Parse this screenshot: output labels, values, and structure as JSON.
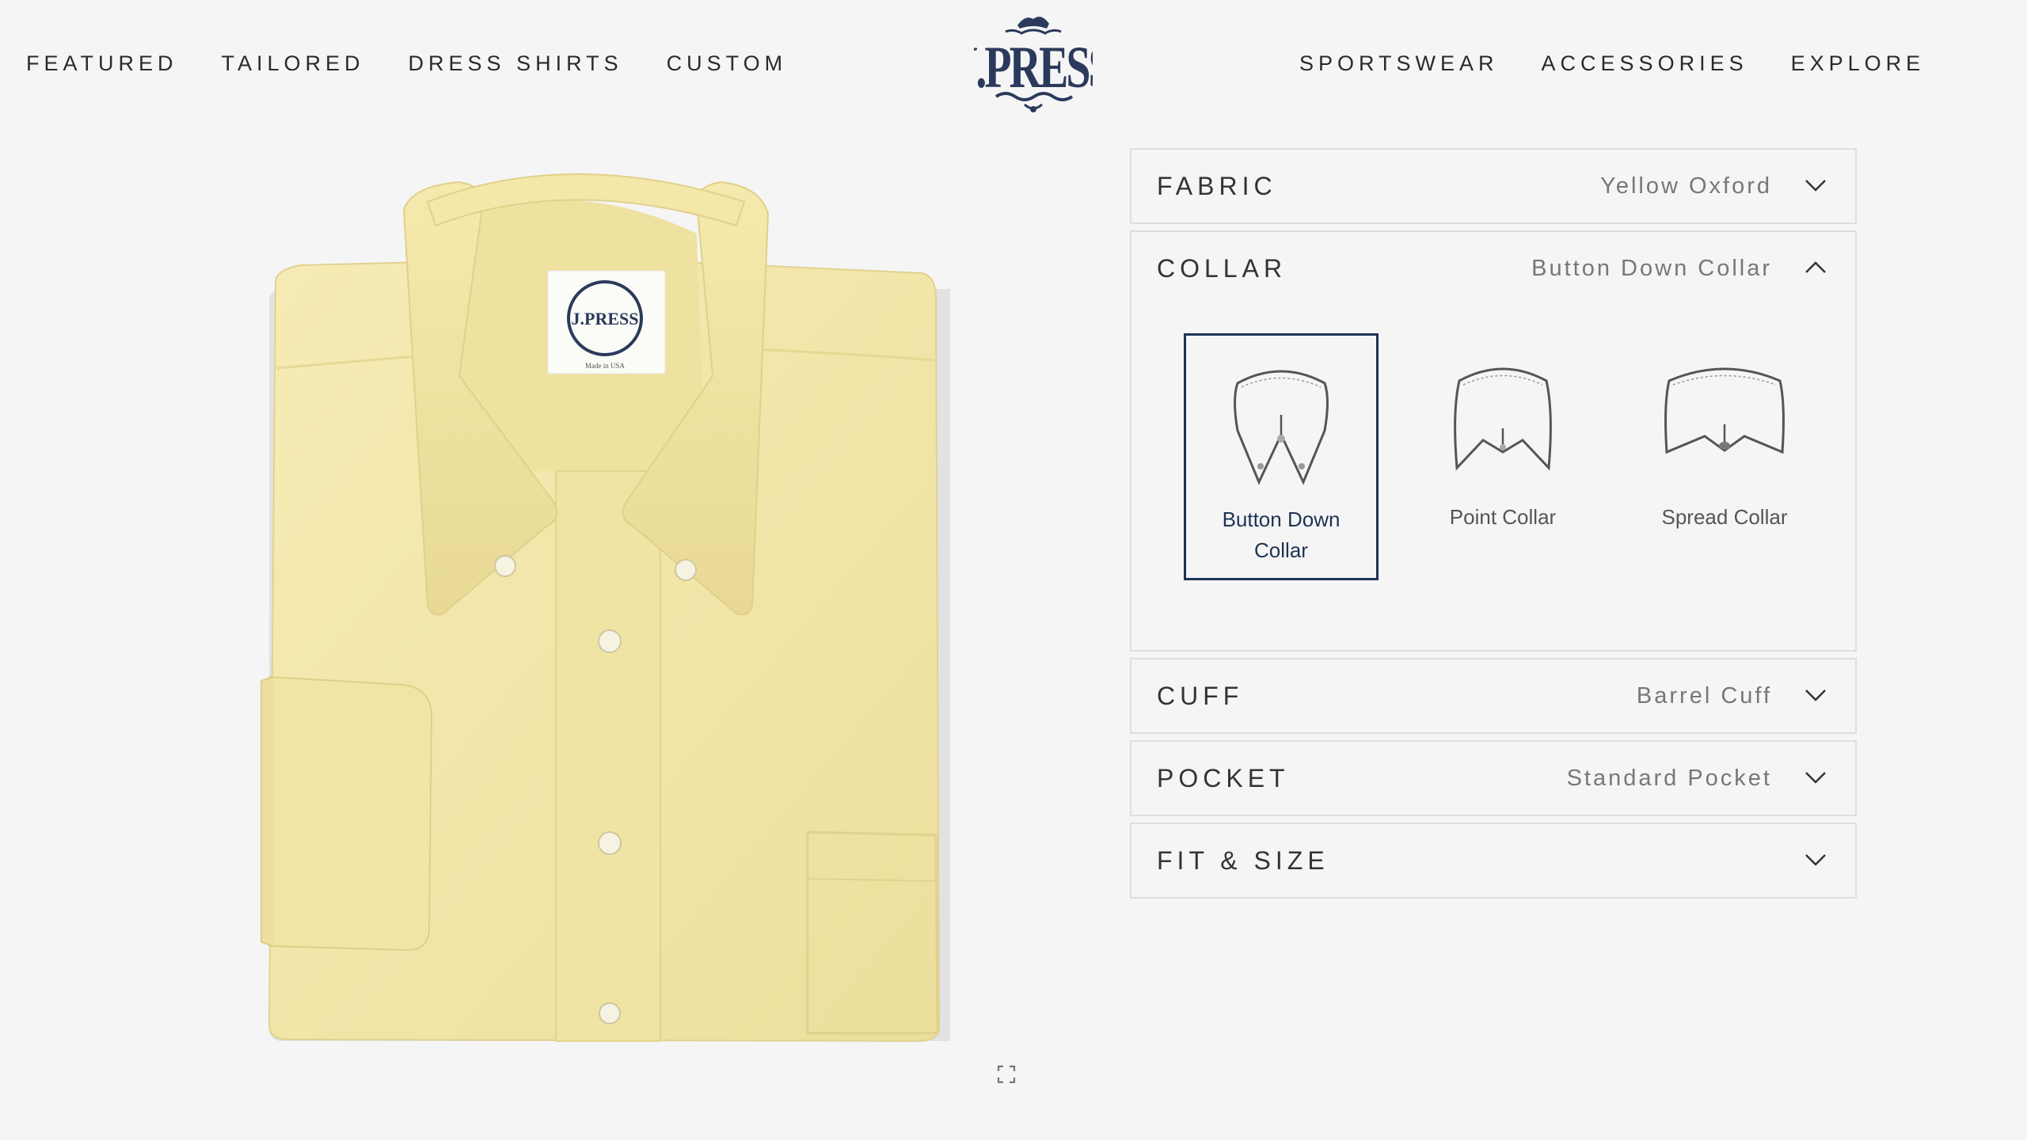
{
  "nav": {
    "left": [
      "FEATURED",
      "TAILORED",
      "DRESS SHIRTS",
      "CUSTOM"
    ],
    "right": [
      "SPORTSWEAR",
      "ACCESSORIES",
      "EXPLORE"
    ]
  },
  "brand": {
    "logo_text": "J.PRESS",
    "accent": "#2b3a5c"
  },
  "product": {
    "color": "#f2e6a6",
    "label_logo": "J.PRESS",
    "label_small": "Made in USA"
  },
  "configurator": {
    "fabric": {
      "title": "FABRIC",
      "value": "Yellow Oxford",
      "expanded": false
    },
    "collar": {
      "title": "COLLAR",
      "value": "Button Down Collar",
      "expanded": true,
      "options": [
        {
          "label": "Button Down Collar",
          "selected": true
        },
        {
          "label": "Point Collar",
          "selected": false
        },
        {
          "label": "Spread Collar",
          "selected": false
        }
      ]
    },
    "cuff": {
      "title": "CUFF",
      "value": "Barrel Cuff",
      "expanded": false
    },
    "pocket": {
      "title": "POCKET",
      "value": "Standard Pocket",
      "expanded": false
    },
    "fit": {
      "title": "FIT & SIZE",
      "value": "",
      "expanded": false
    }
  },
  "icons": {
    "chevron_down": "chevron-down-icon",
    "chevron_up": "chevron-up-icon",
    "zoom": "expand-icon"
  }
}
